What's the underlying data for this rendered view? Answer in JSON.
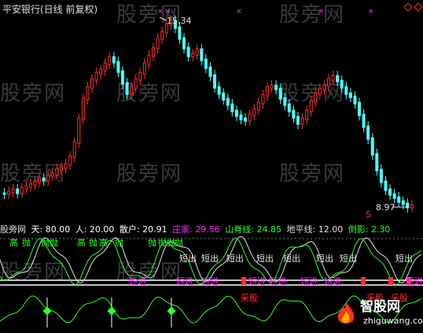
{
  "watermark": "股旁网",
  "header": {
    "title": "平安银行(日线 前复权)",
    "price_high": "15.34",
    "price_low": "8.97"
  },
  "indicator_bar": {
    "name": "股旁网",
    "tian": "天: 80.00",
    "ren": "人: 20.00",
    "sanhu": "散户: 20.91",
    "zhuangjia": "庄家: 29.56",
    "shanji": "山脊线: 24.85",
    "dipingxian": "地平线: 12.00",
    "daoying": "倒影: 2.30"
  },
  "signals": {
    "gao": "高",
    "pao": "抛",
    "duanchu": "短出",
    "duanjin": "短进",
    "caigu": "采股",
    "s_marker": "S"
  },
  "logo": {
    "name": "智股网",
    "url": "zhiguwang.com"
  },
  "colors": {
    "up": "#ff3030",
    "down": "#50ffff",
    "ind_green": "#30ff30",
    "ind_white": "#ffffff",
    "ind_magenta": "#ff30ff"
  }
}
